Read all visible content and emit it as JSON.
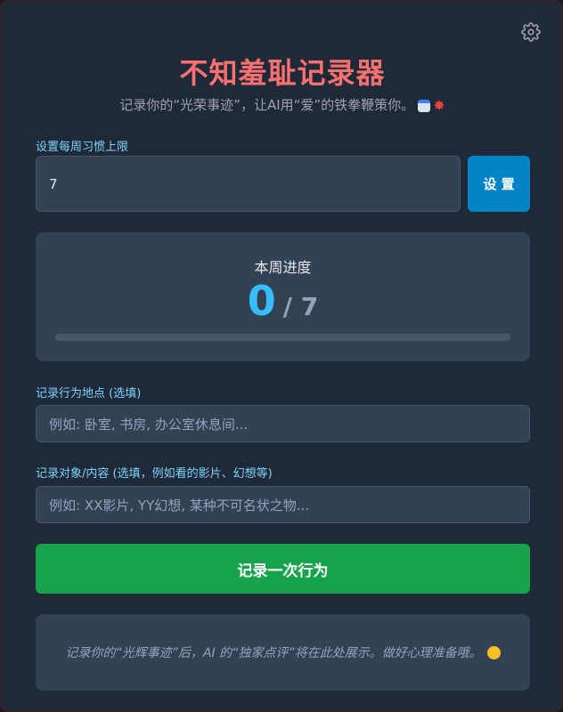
{
  "app": {
    "title": "不知羞耻记录器",
    "subtitle": "记录你的“光荣事迹”，让AI用“爱”的铁拳鞭策你。"
  },
  "icons": {
    "settings": "gear-icon",
    "subtitle_emojis": [
      "calendar-icon",
      "collision-icon"
    ],
    "ai_emoji": "smiling-face-icon"
  },
  "weekly_limit": {
    "label": "设置每周习惯上限",
    "value": "7",
    "button_label": "设 置"
  },
  "progress": {
    "label": "本周进度",
    "current": "0",
    "limit": "/ 7",
    "fraction": 0
  },
  "location": {
    "label": "记录行为地点 (选填)",
    "placeholder": "例如: 卧室, 书房, 办公室休息间..."
  },
  "content": {
    "label": "记录对象/内容 (选填，例如看的影片、幻想等)",
    "placeholder": "例如: XX影片, YY幻想, 某种不可名状之物..."
  },
  "record_button": {
    "label": "记录一次行为"
  },
  "ai_review": {
    "text": "记录你的“光辉事迹”后，AI 的“独家点评”将在此处展示。做好心理准备哦。"
  },
  "colors": {
    "accent_title": "#f87171",
    "primary_button": "#0284c7",
    "record_button": "#16a34a",
    "progress": "#38bdf8"
  }
}
